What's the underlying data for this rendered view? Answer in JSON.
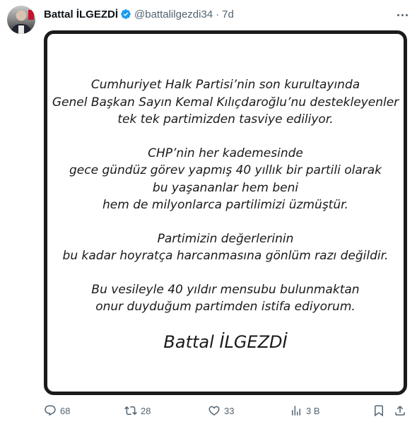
{
  "author": {
    "name": "Battal İLGEZDİ",
    "handle": "@battalilgezdi34",
    "separator": "·",
    "time": "7d"
  },
  "statement": {
    "paragraphs": [
      [
        "Cumhuriyet Halk Partisi’nin son kurultayında",
        "Genel Başkan Sayın Kemal Kılıçdaroğlu’nu destekleyenler",
        "tek tek partimizden tasviye ediliyor."
      ],
      [
        "CHP’nin her kademesinde",
        "gece gündüz görev yapmış 40 yıllık bir partili olarak",
        "bu yaşananlar hem beni",
        "hem de milyonlarca partilimizi üzmüştür."
      ],
      [
        "Partimizin değerlerinin",
        "bu kadar hoyratça harcanmasına gönlüm razı değildir."
      ],
      [
        "Bu vesileyle 40 yıldır mensubu bulunmaktan",
        "onur duyduğum partimden istifa ediyorum."
      ]
    ],
    "signature": "Battal İLGEZDİ"
  },
  "actions": {
    "replies": "68",
    "reposts": "28",
    "likes": "33",
    "views": "3 B"
  },
  "icons": {
    "verified": "verified-badge-icon",
    "reply": "reply-icon",
    "repost": "repost-icon",
    "like": "heart-icon",
    "views": "views-chart-icon",
    "bookmark": "bookmark-icon",
    "share": "share-icon"
  },
  "colors": {
    "verified": "#1d9bf0",
    "muted": "#536471",
    "text": "#0f1419"
  }
}
